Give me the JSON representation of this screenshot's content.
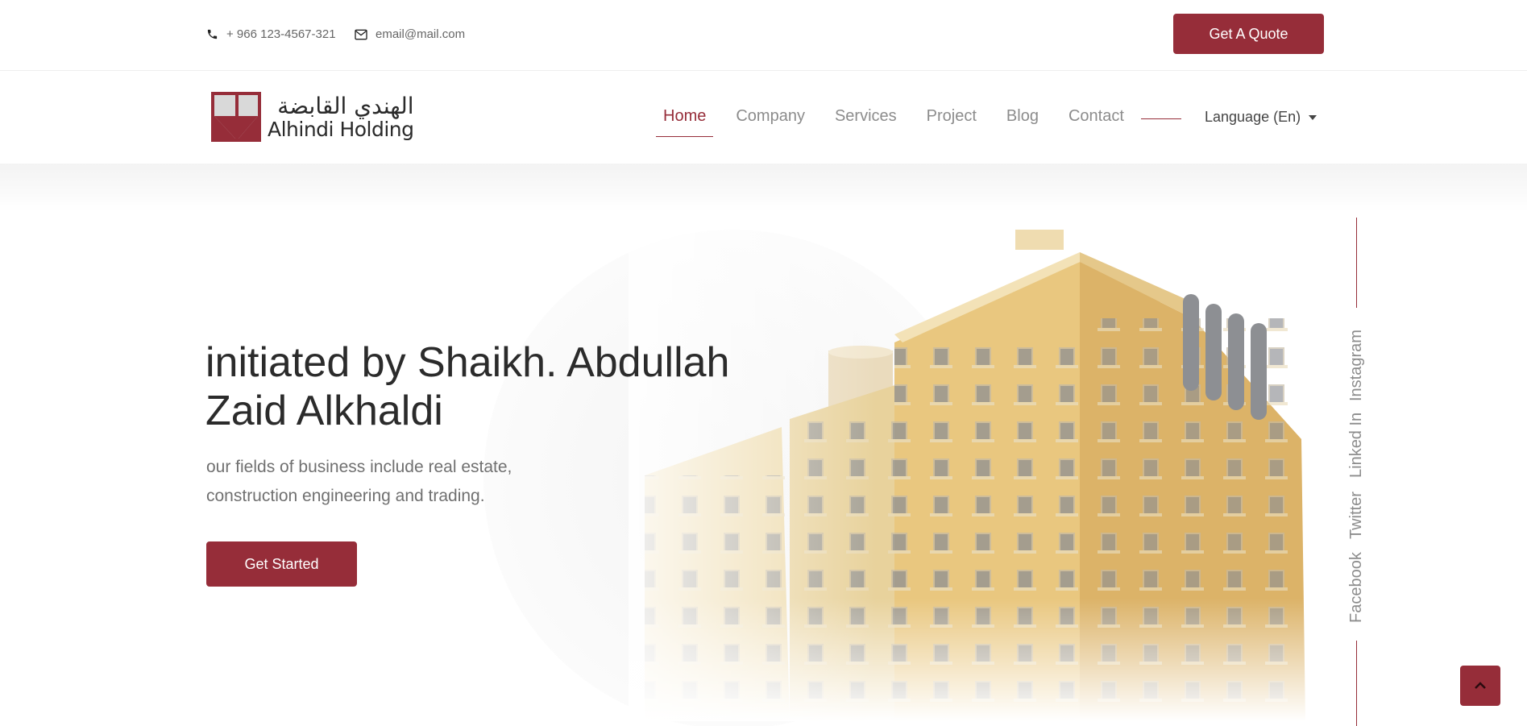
{
  "topbar": {
    "phone": "+ 966 123-4567-321",
    "email": "email@mail.com",
    "quote_label": "Get A Quote"
  },
  "logo": {
    "arabic": "الهندي القابضة",
    "english": "Alhindi Holding",
    "icon": "logo-mark-icon"
  },
  "nav": {
    "items": [
      {
        "label": "Home",
        "active": true
      },
      {
        "label": "Company",
        "active": false
      },
      {
        "label": "Services",
        "active": false
      },
      {
        "label": "Project",
        "active": false
      },
      {
        "label": "Blog",
        "active": false
      },
      {
        "label": "Contact",
        "active": false
      }
    ],
    "language": "Language (En)"
  },
  "hero": {
    "title": "initiated by Shaikh. Abdullah Zaid Alkhaldi",
    "text": "our fields of business include real estate, construction engineering and trading.",
    "button": "Get Started"
  },
  "social": {
    "items": [
      "Instagram",
      "Linked In",
      "Twitter",
      "Facebook"
    ]
  },
  "colors": {
    "accent": "#962d39",
    "nav_text": "#8c8c8c",
    "heading": "#2b2b2b"
  },
  "icons": {
    "phone": "phone-icon",
    "email": "envelope-icon",
    "scroll_top": "chevron-up-icon"
  }
}
